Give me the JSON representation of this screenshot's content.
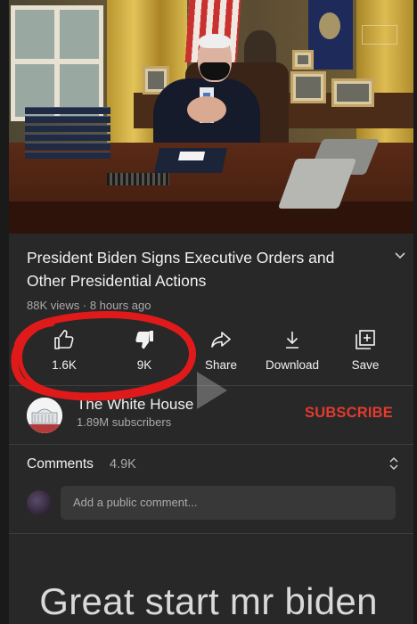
{
  "video": {
    "title_line1": "President Biden Signs Executive Orders and",
    "title_line2": "Other Presidential Actions",
    "views": "88K views",
    "age": "8 hours ago"
  },
  "actions": {
    "like_count": "1.6K",
    "dislike_count": "9K",
    "share_label": "Share",
    "download_label": "Download",
    "save_label": "Save"
  },
  "channel": {
    "name": "The White House",
    "subscribers": "1.89M subscribers",
    "subscribe_label": "SUBSCRIBE"
  },
  "comments": {
    "label": "Comments",
    "count": "4.9K",
    "placeholder": "Add a public comment..."
  },
  "overlay_caption": "Great start mr biden",
  "colors": {
    "background": "#282828",
    "subscribe": "#e33b2e",
    "annotation": "#e01a1a"
  },
  "icons": [
    "expand-chevron-icon",
    "thumbs-up-icon",
    "thumbs-down-icon",
    "share-arrow-icon",
    "download-icon",
    "save-playlist-icon",
    "sort-comments-icon",
    "play-icon"
  ]
}
